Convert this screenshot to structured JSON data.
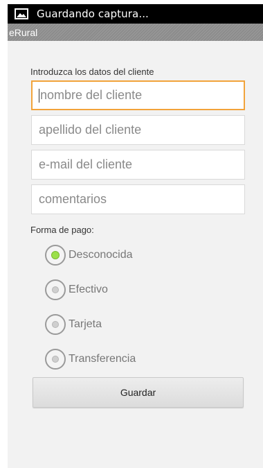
{
  "status_bar": {
    "notification_text": "Guardando captura...",
    "icon": "image-icon"
  },
  "app_bar": {
    "title": "eRural"
  },
  "form": {
    "prompt": "Introduzca los datos del cliente",
    "fields": [
      {
        "placeholder": "nombre del cliente",
        "focused": true
      },
      {
        "placeholder": "apellido del cliente",
        "focused": false
      },
      {
        "placeholder": "e-mail del cliente",
        "focused": false
      },
      {
        "placeholder": "comentarios",
        "focused": false
      }
    ],
    "payment_label": "Forma de pago:",
    "payment_options": [
      {
        "label": "Desconocida",
        "checked": true
      },
      {
        "label": "Efectivo",
        "checked": false
      },
      {
        "label": "Tarjeta",
        "checked": false
      },
      {
        "label": "Transferencia",
        "checked": false
      }
    ],
    "save_label": "Guardar"
  },
  "colors": {
    "focus": "#f2a33a",
    "radio_checked": "#9be04a",
    "status_bar": "#000000"
  }
}
